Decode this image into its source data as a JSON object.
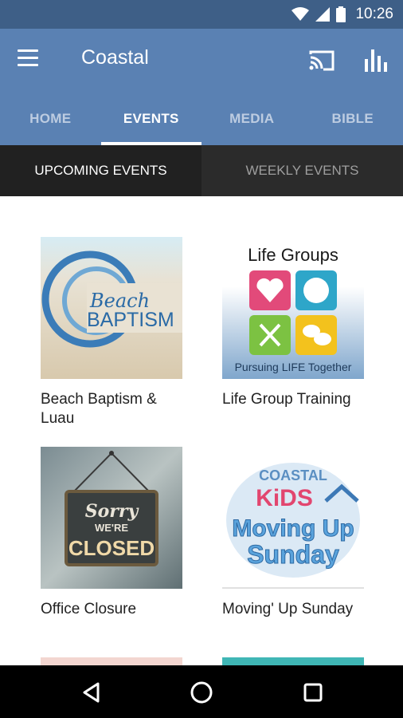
{
  "status_bar": {
    "time": "10:26"
  },
  "app_bar": {
    "title": "Coastal"
  },
  "tabs": [
    {
      "label": "HOME",
      "active": false
    },
    {
      "label": "EVENTS",
      "active": true
    },
    {
      "label": "MEDIA",
      "active": false
    },
    {
      "label": "BIBLE",
      "active": false
    }
  ],
  "sub_tabs": {
    "upcoming": "UPCOMING EVENTS",
    "weekly": "WEEKLY EVENTS"
  },
  "events": [
    {
      "title": "Beach Baptism & Luau",
      "image_text": [
        "Beach",
        "BAPTISM"
      ]
    },
    {
      "title": "Life Group Training",
      "image_text": [
        "Life Groups",
        "Pursuing LIFE Together"
      ]
    },
    {
      "title": "Office Closure",
      "image_text": [
        "Sorry",
        "WE'RE",
        "CLOSED"
      ]
    },
    {
      "title": "Moving' Up Sunday",
      "image_text": [
        "COASTAL",
        "KiDS",
        "Moving Up",
        "Sunday"
      ]
    }
  ],
  "colors": {
    "app_bar": "#5a81b3",
    "status_bar": "#3e5f87",
    "sub_tab_active": "#212121"
  }
}
